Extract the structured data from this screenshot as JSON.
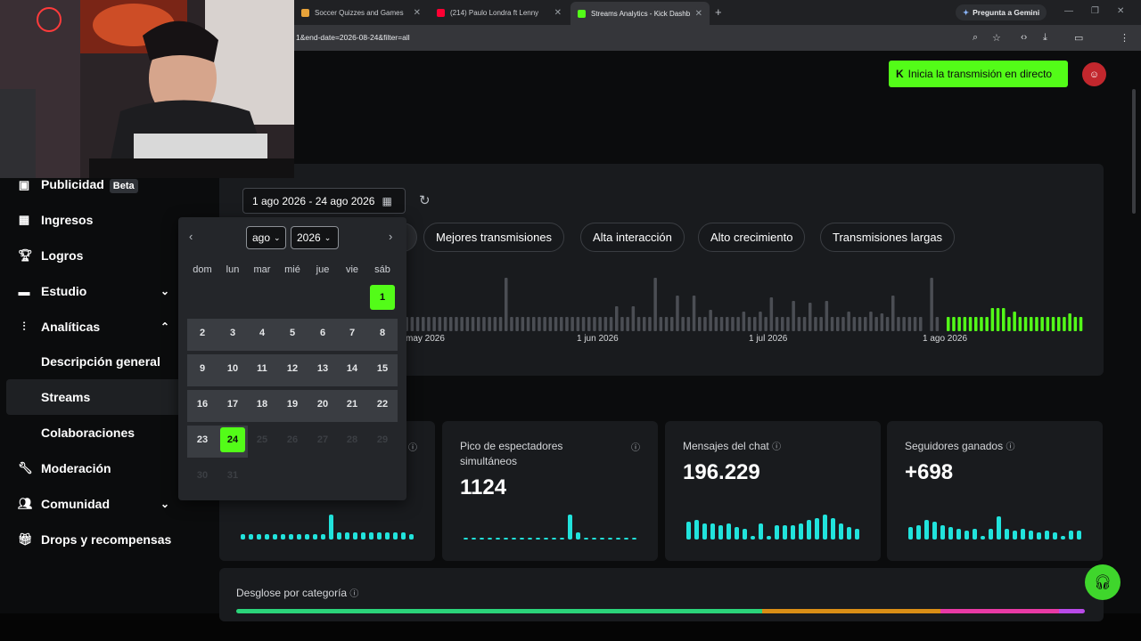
{
  "browser": {
    "tabs": [
      {
        "title": "Soccer Quizzes and Games",
        "fav": "#e8a33a"
      },
      {
        "title": "(214) Paulo Londra ft Lenny",
        "fav": "#ff0033"
      },
      {
        "title": "Streams Analytics - Kick Dashb",
        "fav": "#53fc18"
      }
    ],
    "gemini_label": "Pregunta a Gemini",
    "url": "1&end-date=2026-08-24&filter=all"
  },
  "header": {
    "go_live_label": "Inicia la transmisión en directo"
  },
  "sidebar": {
    "items": [
      {
        "label": "Publicidad",
        "badge": "Beta"
      },
      {
        "label": "Ingresos"
      },
      {
        "label": "Logros"
      },
      {
        "label": "Estudio"
      },
      {
        "label": "Analíticas"
      },
      {
        "label": "Descripción general"
      },
      {
        "label": "Streams"
      },
      {
        "label": "Colaboraciones"
      },
      {
        "label": "Moderación"
      },
      {
        "label": "Comunidad"
      },
      {
        "label": "Drops y recompensas"
      }
    ]
  },
  "filters": {
    "date_range": "1 ago 2026 - 24 ago 2026",
    "chips": [
      "Mejores transmisiones",
      "Alta interacción",
      "Alto crecimiento",
      "Transmisiones largas"
    ]
  },
  "timeline": {
    "labels": [
      "may 2026",
      "1 jun 2026",
      "1 jul 2026",
      "1 ago 2026"
    ],
    "accent": "#53fc18",
    "inactive": "#4b4e54"
  },
  "calendar": {
    "month": "ago",
    "year": "2026",
    "weekdays": [
      "dom",
      "lun",
      "mar",
      "mié",
      "jue",
      "vie",
      "sáb"
    ],
    "selected_start": "1",
    "selected_end": "24"
  },
  "stats": [
    {
      "title": "Pico de espectadores simultáneos",
      "value": "1124"
    },
    {
      "title": "Mensajes del chat",
      "value": "196.229"
    },
    {
      "title": "Seguidores ganados",
      "value": "+698"
    }
  ],
  "breakdown": {
    "title": "Desglose por categoría"
  },
  "colors": {
    "kick_green": "#53fc18",
    "spark": "#21e3dc"
  }
}
